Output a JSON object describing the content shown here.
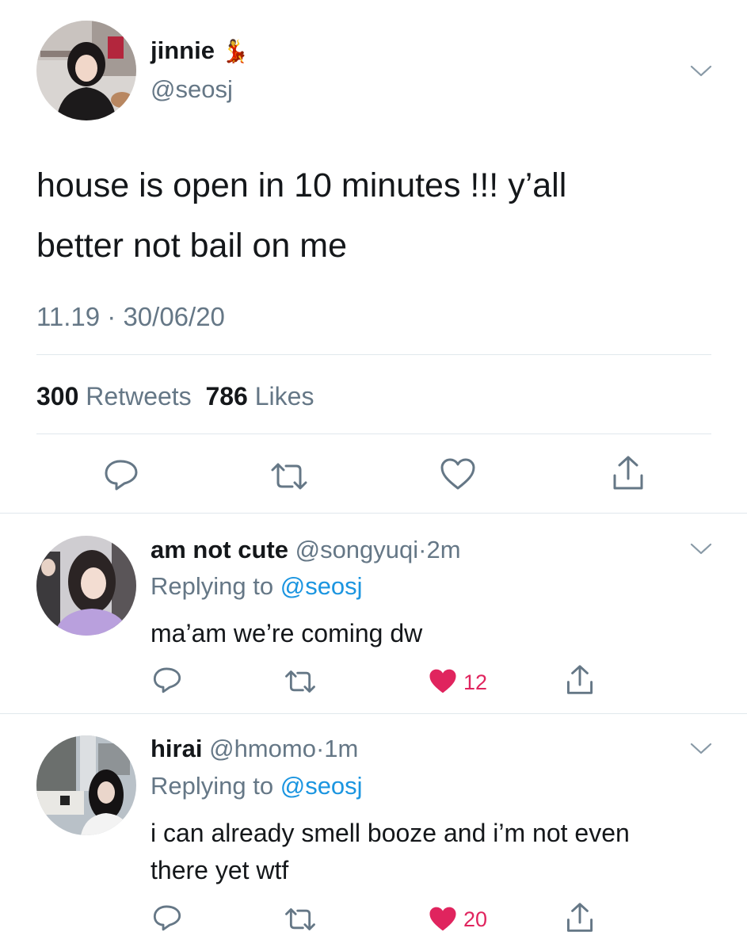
{
  "main_tweet": {
    "display_name": "jinnie",
    "name_emoji": "💃",
    "handle": "@seosj",
    "text_line1": "house is open in 10 minutes !!! y’all",
    "text_line2": "better not bail on me",
    "timestamp": "11.19 · 30/06/20",
    "retweets_count": "300",
    "retweets_label": "Retweets",
    "likes_count": "786",
    "likes_label": "Likes"
  },
  "replies": [
    {
      "display_name": "am not cute",
      "handle": "@songyuqi",
      "separator": "·",
      "time": "2m",
      "replying_prefix": "Replying to",
      "replying_to": "@seosj",
      "text_line1": "ma’am we’re coming dw",
      "like_count": "12"
    },
    {
      "display_name": "hirai",
      "handle": "@hmomo",
      "separator": "·",
      "time": "1m",
      "replying_prefix": "Replying to",
      "replying_to": "@seosj",
      "text_line1": "i can already smell booze and i’m not even",
      "text_line2": "there yet wtf",
      "like_count": "20"
    }
  ],
  "icons": [
    "chevron-down-icon",
    "reply-icon",
    "retweet-icon",
    "like-icon",
    "share-icon",
    "dancer-emoji"
  ],
  "colors": {
    "text": "#14171a",
    "muted": "#657786",
    "link": "#1b95e0",
    "like": "#e0245e",
    "divider": "#e1e8ed"
  }
}
